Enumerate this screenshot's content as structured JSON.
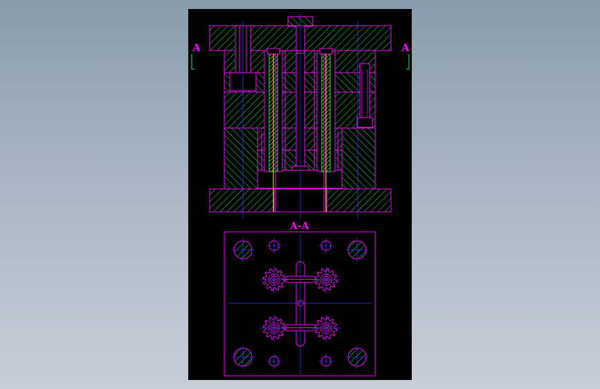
{
  "labels": {
    "section_left": "A",
    "section_right": "A",
    "view_title": "A-A"
  },
  "colors": {
    "background_top": "#8a9bae",
    "background_bottom": "#c6ced8",
    "sheet": "#000000",
    "outline": "#ff00ff",
    "hatch": "#00ff66",
    "centerline": "#2f3cff",
    "pin_yellow": "#ffff00",
    "section_arrow": "#00ff66"
  },
  "icons": {
    "gear": "gear-icon",
    "section_arrow": "section-arrow-icon"
  }
}
